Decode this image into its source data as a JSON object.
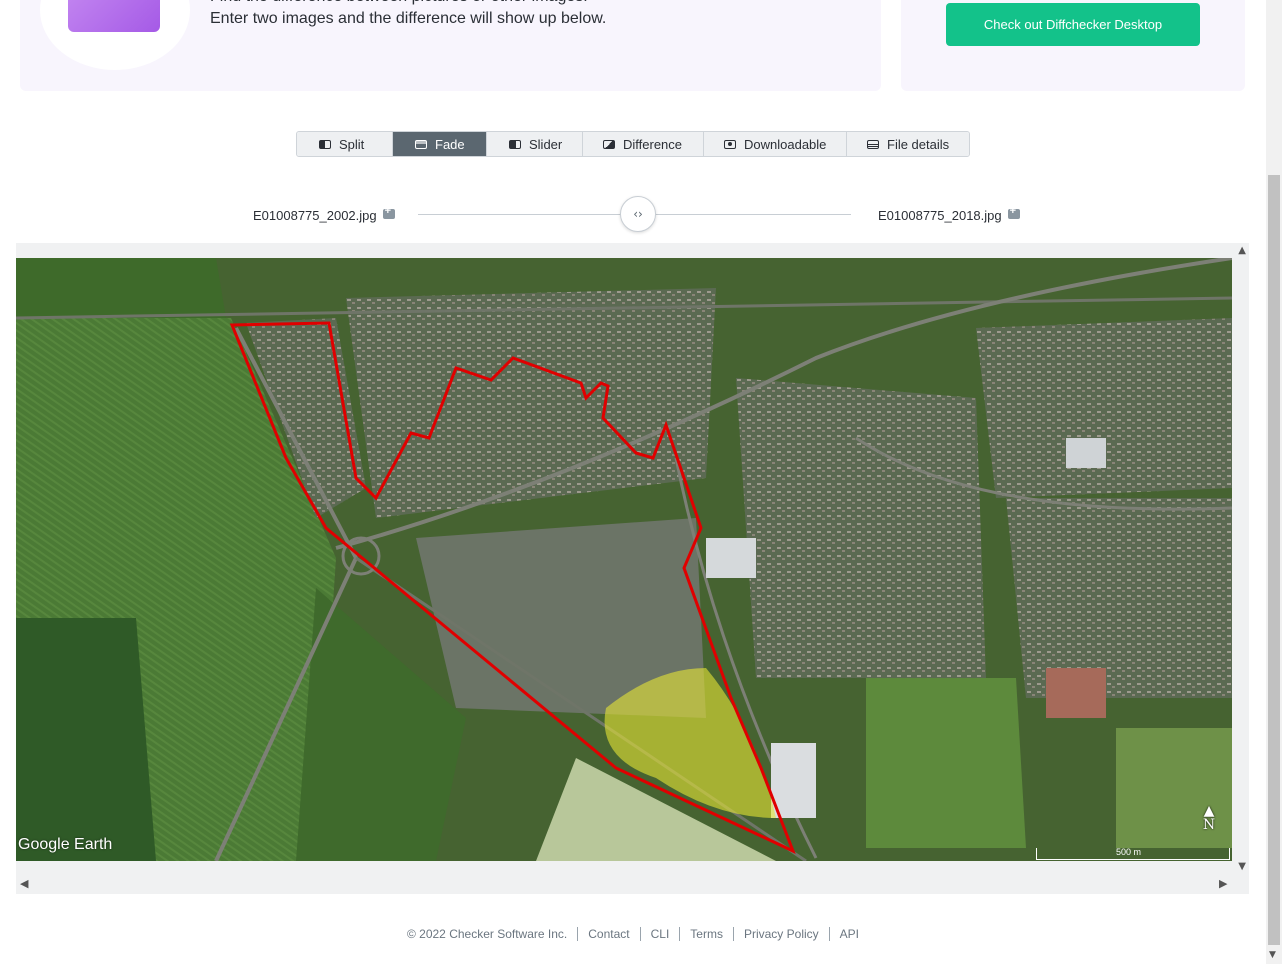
{
  "hero": {
    "line1": "Find the difference between pictures or other images!",
    "line2": "Enter two images and the difference will show up below."
  },
  "promo": {
    "button_label": "Check out Diffchecker Desktop",
    "accent": "#13c28a"
  },
  "tabs": [
    {
      "label": "Split",
      "icon": "split-view-icon",
      "active": false
    },
    {
      "label": "Fade",
      "icon": "fade-view-icon",
      "active": true
    },
    {
      "label": "Slider",
      "icon": "slider-view-icon",
      "active": false
    },
    {
      "label": "Difference",
      "icon": "difference-view-icon",
      "active": false
    },
    {
      "label": "Downloadable",
      "icon": "camera-icon",
      "active": false
    },
    {
      "label": "File details",
      "icon": "file-details-icon",
      "active": false
    }
  ],
  "files": {
    "left": "E01008775_2002.jpg",
    "right": "E01008775_2018.jpg"
  },
  "slider": {
    "handle_glyph": "‹›"
  },
  "map": {
    "watermark": "Google Earth",
    "scale_label": "500 m",
    "north_label": "N",
    "boundary_color": "#e00000",
    "highlight_color": "#e6e635"
  },
  "scroll": {
    "up": "▲",
    "down": "▼",
    "left": "◀",
    "right": "▶"
  },
  "footer": {
    "copyright": "© 2022 Checker Software Inc.",
    "links": [
      "Contact",
      "CLI",
      "Terms",
      "Privacy Policy",
      "API"
    ]
  }
}
